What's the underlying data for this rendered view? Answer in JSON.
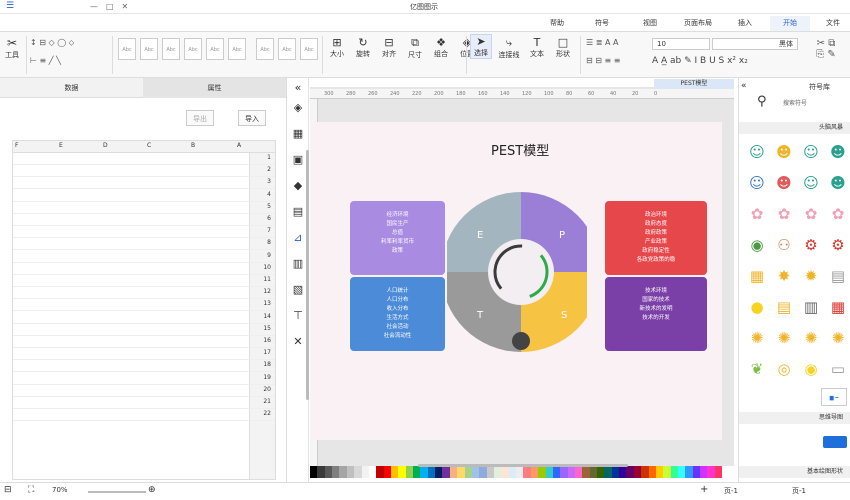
{
  "app": {
    "title": "亿图图示"
  },
  "tabs": [
    "文件",
    "开始",
    "插入",
    "页面布局",
    "视图",
    "符号",
    "帮助"
  ],
  "active_tab": "开始",
  "ribbon": {
    "select": "选择",
    "text": "文本",
    "connector": "连接线",
    "shape": "形状",
    "tools": "工具",
    "position": "位置",
    "align": "对齐",
    "group": "组合",
    "rotate": "旋转",
    "size": "大小",
    "same_size": "尺寸",
    "font_name": "黑体",
    "font_size": "10",
    "style_label": "Abc"
  },
  "left_panel": {
    "tabs": [
      "数据",
      "属性"
    ],
    "import_button": "导入",
    "export_button": "导出",
    "columns": [
      "A",
      "B",
      "C",
      "D",
      "E",
      "F"
    ],
    "rows": [
      "1",
      "2",
      "3",
      "4",
      "5",
      "6",
      "7",
      "8",
      "9",
      "10",
      "11",
      "12",
      "13",
      "14",
      "15",
      "16",
      "17",
      "18",
      "19",
      "20",
      "21",
      "22"
    ]
  },
  "ruler_ticks": [
    "300",
    "280",
    "260",
    "240",
    "220",
    "200",
    "180",
    "160",
    "140",
    "120",
    "100",
    "80",
    "60",
    "40",
    "20",
    "0"
  ],
  "diagram": {
    "title": "PEST模型",
    "letters": {
      "p": "P",
      "e": "E",
      "s": "S",
      "t": "T"
    },
    "cards": {
      "top_right": [
        "政治环境",
        "政府态度",
        "政府政策",
        "产业政策",
        "政府稳定性",
        "各政党政策的稳"
      ],
      "top_left": [
        "经济环境",
        "国民生产",
        "总值",
        "利率利率货币",
        "政策"
      ],
      "bottom_left": [
        "人口统计",
        "人口分布",
        "收入分布",
        "生活方式",
        "社会活动",
        "社会流动性"
      ],
      "bottom_right": [
        "技术环境",
        "国家的技术",
        "新技术的发明",
        "技术的开发"
      ]
    },
    "colors": {
      "p": "#9b7fd6",
      "s": "#f6c343",
      "t": "#9a9a9a",
      "e": "#a3b6c0",
      "red": "#e6474a",
      "lilac": "#a98be2",
      "blue": "#4c8bd7",
      "purple": "#7b3fa8"
    }
  },
  "right_panel": {
    "title": "符号库",
    "search_placeholder": "搜索符号",
    "category1": "头脑风暴",
    "category2": "思维导图",
    "category3": "基本绘图形状"
  },
  "status": {
    "page": "页-1",
    "page_tab": "页-1",
    "add": "+",
    "zoom": "70%",
    "fullscreen": "⛶"
  },
  "palette": [
    "#000000",
    "#3a3a3a",
    "#595959",
    "#7f7f7f",
    "#a5a5a5",
    "#bfbfbf",
    "#d8d8d8",
    "#f2f2f2",
    "#ffffff",
    "#c00000",
    "#ff0000",
    "#ffc000",
    "#ffff00",
    "#92d050",
    "#00b050",
    "#00b0f0",
    "#0070c0",
    "#002060",
    "#7030a0",
    "#f4b183",
    "#ffd966",
    "#a9d18e",
    "#9dc3e6",
    "#8faadc",
    "#c9c9c9",
    "#e2efda",
    "#fce4d6",
    "#ddebf7",
    "#ededed",
    "#ff7c80",
    "#ff9966",
    "#99cc00",
    "#33cccc",
    "#3366ff",
    "#9966ff",
    "#cc66ff",
    "#ff66cc",
    "#996633",
    "#666633",
    "#336600",
    "#006666",
    "#003399",
    "#330099",
    "#660066",
    "#990033",
    "#cc3300",
    "#ff6600",
    "#ffcc00",
    "#ccff33",
    "#33ff99",
    "#33ffff",
    "#3399ff",
    "#6633ff",
    "#cc33ff",
    "#ff33cc",
    "#ff3366"
  ]
}
